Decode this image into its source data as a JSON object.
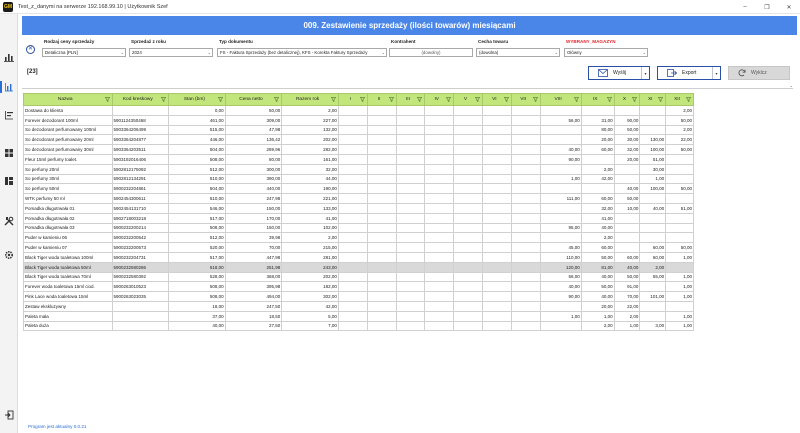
{
  "window": {
    "title": "Test_z_danymi na serwerze 192.168.99.10 | Użytkownik Szef",
    "logo_text": "GM",
    "controls": [
      "–",
      "❐",
      "✕"
    ]
  },
  "header": {
    "title": "009. Zestawienie sprzedaży (ilości towarów) miesiącami"
  },
  "filters": {
    "price_type": {
      "label": "Rodzaj ceny sprzedaży",
      "value": "Detaliczna [PLN]"
    },
    "year": {
      "label": "Sprzedaż z roku",
      "value": "2024"
    },
    "doc_type": {
      "label": "Typ dokumentu",
      "value": "FS - Faktura Sprzedaży (bez detalicznej), KFS - Korekta Faktury Sprzedaży"
    },
    "contractor": {
      "label": "Kontrahent",
      "value": "(dowolny)"
    },
    "feature": {
      "label": "Cecha towaru",
      "value": "(dowolna)"
    },
    "warehouse": {
      "label": "WYBRANY_MAGAZYN",
      "value": "Główny"
    }
  },
  "summary": {
    "count": "[23]"
  },
  "actions": {
    "send": "Wyślij",
    "export": "Export",
    "exclude": "Wyklcz"
  },
  "grid": {
    "columns": [
      "Nazwa",
      "Kod kreskowy",
      "Stan (bm)",
      "Cena netto",
      "Razem rok",
      "I",
      "II",
      "III",
      "IV",
      "V",
      "VI",
      "VII",
      "VIII",
      "IX",
      "X",
      "XI",
      "XII"
    ],
    "rows": [
      [
        "Dostawa do klienta",
        "",
        "0,00",
        "50,00",
        "2,00",
        "",
        "",
        "",
        "",
        "",
        "",
        "",
        "",
        "",
        "",
        "",
        "2,00"
      ],
      [
        "Forever dezodorant 100ml",
        "5901124350468",
        "461,00",
        "309,00",
        "227,00",
        "",
        "",
        "",
        "",
        "",
        "",
        "",
        "56,00",
        "31,00",
        "90,00",
        "",
        "50,00"
      ],
      [
        "So dezodorant perfumowany 100ml",
        "5903364206499",
        "515,00",
        "47,98",
        "132,00",
        "",
        "",
        "",
        "",
        "",
        "",
        "",
        "",
        "80,00",
        "50,00",
        "",
        "2,00"
      ],
      [
        "So dezodorant perfumowany 20ml",
        "5903364204877",
        "446,00",
        "136,42",
        "202,00",
        "",
        "",
        "",
        "",
        "",
        "",
        "",
        "",
        "20,00",
        "30,00",
        "130,00",
        "22,00"
      ],
      [
        "So dezodorant perfumowany 30ml",
        "5903364203511",
        "504,00",
        "289,96",
        "282,00",
        "",
        "",
        "",
        "",
        "",
        "",
        "",
        "40,00",
        "60,00",
        "32,00",
        "100,00",
        "50,00"
      ],
      [
        "Fleur 15ml perfumy toalet.",
        "5903192016406",
        "508,00",
        "80,00",
        "161,00",
        "",
        "",
        "",
        "",
        "",
        "",
        "",
        "90,00",
        "",
        "20,00",
        "51,00",
        ""
      ],
      [
        "So perfumy 20ml",
        "5902812175092",
        "512,00",
        "300,00",
        "32,00",
        "",
        "",
        "",
        "",
        "",
        "",
        "",
        "",
        "2,00",
        "",
        "30,00",
        ""
      ],
      [
        "So perfumy 30ml",
        "5902812134291",
        "510,00",
        "390,00",
        "44,00",
        "",
        "",
        "",
        "",
        "",
        "",
        "",
        "1,00",
        "42,00",
        "",
        "1,00",
        ""
      ],
      [
        "So perfumy 50ml",
        "5900232204861",
        "504,00",
        "440,00",
        "190,00",
        "",
        "",
        "",
        "",
        "",
        "",
        "",
        "",
        "",
        "40,00",
        "100,00",
        "50,00"
      ],
      [
        "WTK perfumy 50 ml",
        "5902454300611",
        "510,00",
        "247,98",
        "221,00",
        "",
        "",
        "",
        "",
        "",
        "",
        "",
        "111,00",
        "60,00",
        "50,00",
        "",
        ""
      ],
      [
        "Pomadka długotrwała 01",
        "5902454131710",
        "546,00",
        "150,00",
        "133,00",
        "",
        "",
        "",
        "",
        "",
        "",
        "",
        "",
        "32,00",
        "10,00",
        "40,00",
        "51,00"
      ],
      [
        "Pomadka długotrwała 02",
        "5902718003218",
        "517,00",
        "170,00",
        "41,00",
        "",
        "",
        "",
        "",
        "",
        "",
        "",
        "",
        "41,00",
        "",
        "",
        ""
      ],
      [
        "Pomadka długotrwała 03",
        "5900232200214",
        "508,00",
        "150,00",
        "102,00",
        "",
        "",
        "",
        "",
        "",
        "",
        "",
        "95,00",
        "40,00",
        "",
        "",
        ""
      ],
      [
        "Puder w kamieniu 06",
        "5900232200542",
        "512,00",
        "39,98",
        "2,00",
        "",
        "",
        "",
        "",
        "",
        "",
        "",
        "",
        "2,00",
        "",
        "",
        ""
      ],
      [
        "Puder w kamieniu 07",
        "5900232200573",
        "520,00",
        "70,00",
        "215,00",
        "",
        "",
        "",
        "",
        "",
        "",
        "",
        "45,00",
        "60,00",
        "",
        "60,00",
        "50,00"
      ],
      [
        "Black Tiger woda toaletowa 100ml",
        "5900232204731",
        "517,00",
        "447,98",
        "281,00",
        "",
        "",
        "",
        "",
        "",
        "",
        "",
        "110,00",
        "50,00",
        "60,00",
        "60,00",
        "1,00"
      ],
      [
        "Black Tiger woda toaletowa 50ml",
        "5900232580286",
        "518,00",
        "251,98",
        "243,00",
        "",
        "",
        "",
        "",
        "",
        "",
        "",
        "120,00",
        "81,00",
        "40,00",
        "2,00",
        ""
      ],
      [
        "Black Tiger woda toaletowa 70ml",
        "5900232580392",
        "528,00",
        "368,00",
        "202,00",
        "",
        "",
        "",
        "",
        "",
        "",
        "",
        "56,00",
        "40,00",
        "50,00",
        "55,00",
        "1,00"
      ],
      [
        "Forever woda toaletowa 15ml ciod.",
        "5900263010523",
        "508,00",
        "395,98",
        "182,00",
        "",
        "",
        "",
        "",
        "",
        "",
        "",
        "40,00",
        "50,00",
        "91,00",
        "",
        "1,00"
      ],
      [
        "Pink Lace woda toaletowa 15ml",
        "5900263023035",
        "508,00",
        "494,00",
        "302,00",
        "",
        "",
        "",
        "",
        "",
        "",
        "",
        "90,00",
        "40,00",
        "70,00",
        "101,00",
        "1,00"
      ],
      [
        "Zestaw ekskluzywny",
        "",
        "18,00",
        "247,50",
        "42,00",
        "",
        "",
        "",
        "",
        "",
        "",
        "",
        "",
        "20,00",
        "22,00",
        "",
        ""
      ],
      [
        "Paleta mała",
        "",
        "37,00",
        "18,50",
        "5,00",
        "",
        "",
        "",
        "",
        "",
        "",
        "",
        "1,00",
        "1,00",
        "2,00",
        "",
        "1,00"
      ],
      [
        "Paleta duża",
        "",
        "40,00",
        "27,50",
        "7,00",
        "",
        "",
        "",
        "",
        "",
        "",
        "",
        "",
        "2,00",
        "1,00",
        "3,00",
        "1,00"
      ]
    ],
    "selected_row": 16
  },
  "status": {
    "text": "Program jest aktualny 0.0.21"
  }
}
